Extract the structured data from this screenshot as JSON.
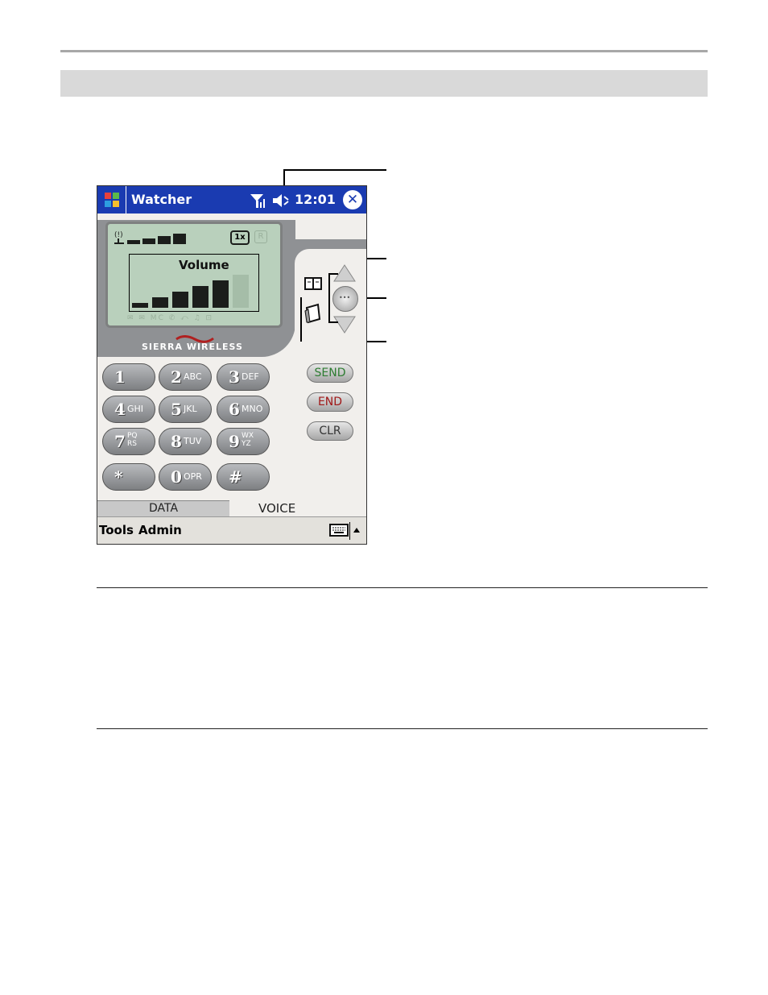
{
  "window": {
    "title": "Watcher",
    "clock": "12:01"
  },
  "lcd": {
    "volume_label": "Volume",
    "indicator_1x": "1x",
    "indicator_r": "R",
    "volume_level": 5,
    "volume_max": 6
  },
  "brand": "SIERRA WIRELESS",
  "keypad": [
    {
      "digit": "1",
      "letters": ""
    },
    {
      "digit": "2",
      "letters": "ABC"
    },
    {
      "digit": "3",
      "letters": "DEF"
    },
    {
      "digit": "4",
      "letters": "GHI"
    },
    {
      "digit": "5",
      "letters": "JKL"
    },
    {
      "digit": "6",
      "letters": "MNO"
    },
    {
      "digit": "7",
      "letters": "PQ RS"
    },
    {
      "digit": "8",
      "letters": "TUV"
    },
    {
      "digit": "9",
      "letters": "WX YZ"
    },
    {
      "digit": "*",
      "letters": ""
    },
    {
      "digit": "0",
      "letters": "OPR"
    },
    {
      "digit": "#",
      "letters": ""
    }
  ],
  "buttons": {
    "send": "SEND",
    "end": "END",
    "clr": "CLR"
  },
  "tabs": {
    "data": "DATA",
    "voice": "VOICE"
  },
  "menu": {
    "tools": "Tools",
    "admin": "Admin"
  },
  "colors": {
    "titlebar": "#1a3bb1",
    "lcd": "#b9d0bc",
    "send_text": "#2e7d32",
    "end_text": "#a01818"
  }
}
